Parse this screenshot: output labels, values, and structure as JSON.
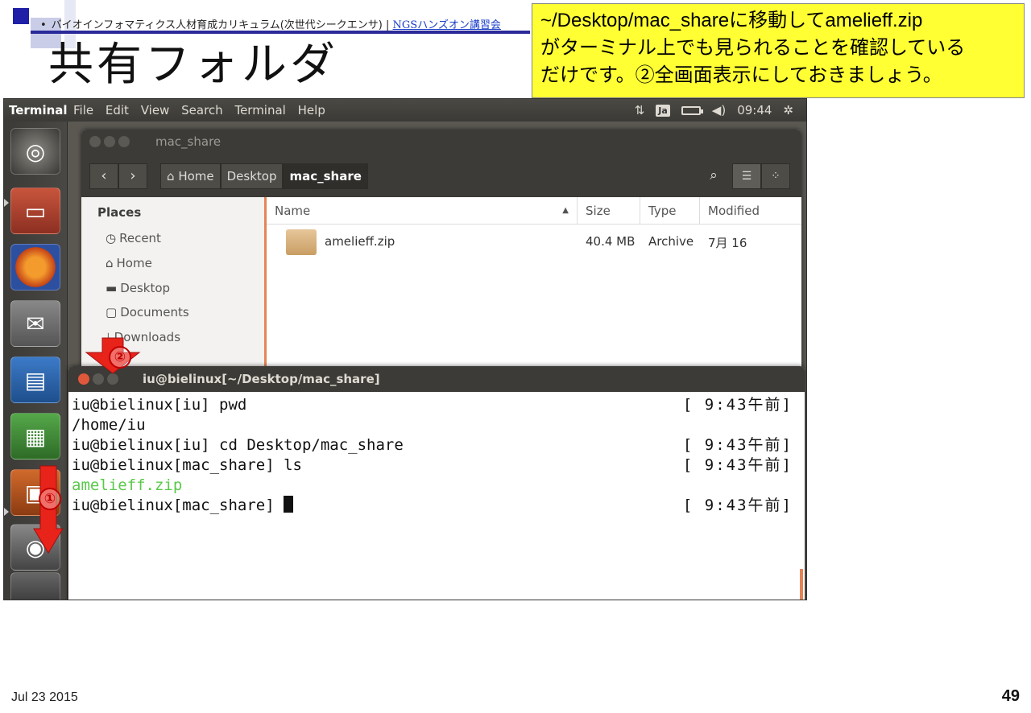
{
  "slide": {
    "header_text": "バイオインフォマティクス人材育成カリキュラム(次世代シークエンサ) | ",
    "header_link": "NGSハンズオン講習会",
    "title": "共有フォルダ",
    "callout": "~/Desktop/mac_shareに移動してamelieff.zip\nがターミナル上でも見られることを確認している\nだけです。②全画面表示にしておきましょう。",
    "date": "Jul 23 2015",
    "page_number": "49",
    "markers": {
      "one": "①",
      "two": "②"
    }
  },
  "menubar": {
    "app_name": "Terminal",
    "menus": [
      "File",
      "Edit",
      "View",
      "Search",
      "Terminal",
      "Help"
    ],
    "input_method": "Ja",
    "time": "09:44"
  },
  "file_manager": {
    "title": "mac_share",
    "breadcrumbs": [
      {
        "label": "Home",
        "active": false
      },
      {
        "label": "Desktop",
        "active": false
      },
      {
        "label": "mac_share",
        "active": true
      }
    ],
    "sidebar_heading": "Places",
    "sidebar_items": [
      {
        "label": "Recent",
        "icon": "clock-icon"
      },
      {
        "label": "Home",
        "icon": "home-icon"
      },
      {
        "label": "Desktop",
        "icon": "folder-icon"
      },
      {
        "label": "Documents",
        "icon": "document-icon"
      },
      {
        "label": "Downloads",
        "icon": "download-icon"
      }
    ],
    "columns": [
      "Name",
      "Size",
      "Type",
      "Modified"
    ],
    "files": [
      {
        "name": "amelieff.zip",
        "size": "40.4 MB",
        "type": "Archive",
        "modified": "7月 16"
      }
    ]
  },
  "terminal": {
    "title": "iu@bielinux[~/Desktop/mac_share]",
    "lines": [
      {
        "text": "iu@bielinux[iu] pwd",
        "time": "[ 9:43午前]"
      },
      {
        "text": "/home/iu",
        "time": ""
      },
      {
        "text": "iu@bielinux[iu] cd Desktop/mac_share",
        "time": "[ 9:43午前]"
      },
      {
        "text": "iu@bielinux[mac_share] ls",
        "time": "[ 9:43午前]"
      },
      {
        "text": "amelieff.zip",
        "time": ""
      },
      {
        "text": "iu@bielinux[mac_share] ",
        "time": "[ 9:43午前]"
      }
    ]
  },
  "colors": {
    "callout_bg": "#ffff33",
    "accent_orange": "#e58457",
    "annotation_red": "#e8231a",
    "listing_green": "#59c94a"
  }
}
